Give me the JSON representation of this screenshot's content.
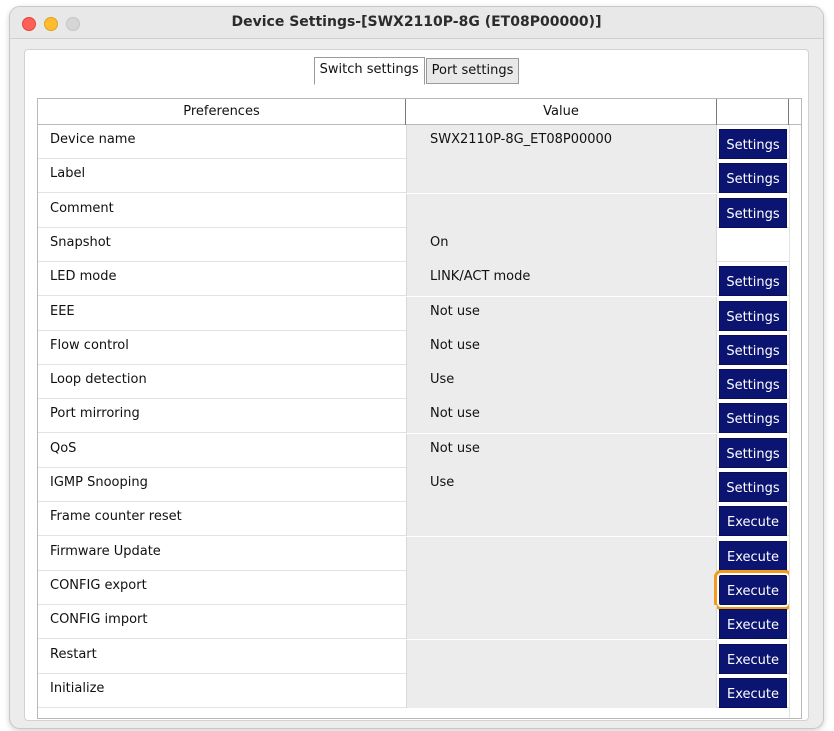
{
  "window": {
    "title": "Device Settings-[SWX2110P-8G (ET08P00000)]"
  },
  "tabs": [
    {
      "label": "Switch settings",
      "active": true
    },
    {
      "label": "Port settings",
      "active": false
    }
  ],
  "table": {
    "columns": [
      "Preferences",
      "Value",
      ""
    ],
    "rows": [
      {
        "pref": "Device name",
        "value": "SWX2110P-8G_ET08P00000",
        "action": "Settings"
      },
      {
        "pref": "Label",
        "value": "",
        "action": "Settings"
      },
      {
        "pref": "Comment",
        "value": "",
        "action": "Settings"
      },
      {
        "pref": "Snapshot",
        "value": "On",
        "action": ""
      },
      {
        "pref": "LED mode",
        "value": "LINK/ACT mode",
        "action": "Settings"
      },
      {
        "pref": "EEE",
        "value": "Not use",
        "action": "Settings"
      },
      {
        "pref": "Flow control",
        "value": "Not use",
        "action": "Settings"
      },
      {
        "pref": "Loop detection",
        "value": "Use",
        "action": "Settings"
      },
      {
        "pref": "Port mirroring",
        "value": "Not use",
        "action": "Settings"
      },
      {
        "pref": "QoS",
        "value": "Not use",
        "action": "Settings"
      },
      {
        "pref": "IGMP Snooping",
        "value": "Use",
        "action": "Settings"
      },
      {
        "pref": "Frame counter reset",
        "value": "",
        "action": "Execute"
      },
      {
        "pref": "Firmware Update",
        "value": "",
        "action": "Execute"
      },
      {
        "pref": "CONFIG export",
        "value": "",
        "action": "Execute",
        "highlighted": true
      },
      {
        "pref": "CONFIG import",
        "value": "",
        "action": "Execute"
      },
      {
        "pref": "Restart",
        "value": "",
        "action": "Execute"
      },
      {
        "pref": "Initialize",
        "value": "",
        "action": "Execute"
      }
    ]
  },
  "colors": {
    "button_bg": "#0b1470",
    "highlight": "#f29a1c",
    "value_cell_bg": "#ececec"
  }
}
